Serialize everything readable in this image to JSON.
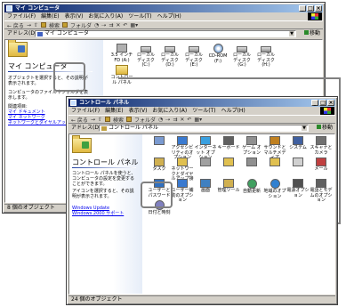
{
  "colors": {
    "title_start": "#0a246a",
    "title_end": "#a6caf0",
    "chrome": "#d4d0c8",
    "link": "#0000ee",
    "callout": "#808080"
  },
  "win1": {
    "title": "マイ コンピュータ",
    "menu": [
      "ファイル(F)",
      "編集(E)",
      "表示(V)",
      "お気に入り(A)",
      "ツール(T)",
      "ヘルプ(H)"
    ],
    "toolbar": {
      "back": "← 戻る",
      "search": "検索",
      "folders": "フォルダ"
    },
    "address_label": "アドレス(D)",
    "address_value": "マイ コンピュータ",
    "go": "移動",
    "panel_title": "マイ コンピュータ",
    "panel_desc": "オブジェクトを選択すると、その説明が表示されます。",
    "panel_desc2": "コンピュータのファイルやフォルダを表示します。",
    "related_heading": "関連項目:",
    "links": [
      "マイ ドキュメント",
      "マイ ネットワーク",
      "ネットワークとダイヤルアップ接続"
    ],
    "icons": [
      {
        "label": "3.5 インチ FD (A:)",
        "icon": "floppy-icon"
      },
      {
        "label": "ローカル ディスク (C:)",
        "icon": "drive-icon"
      },
      {
        "label": "ローカル ディスク (D:)",
        "icon": "drive-icon"
      },
      {
        "label": "ローカル ディスク (E:)",
        "icon": "drive-icon"
      },
      {
        "label": "CD-ROM (F:)",
        "icon": "cdrom-icon"
      },
      {
        "label": "ローカル ディスク (G:)",
        "icon": "drive-icon"
      },
      {
        "label": "ローカル ディスク (H:)",
        "icon": "drive-icon"
      }
    ],
    "control_panel_label": "コントロール パネル",
    "status": "8 個のオブジェクト"
  },
  "win2": {
    "title": "コントロール パネル",
    "menu": [
      "ファイル(F)",
      "編集(E)",
      "表示(V)",
      "お気に入り(A)",
      "ツール(T)",
      "ヘルプ(H)"
    ],
    "toolbar": {
      "back": "← 戻る",
      "search": "検索",
      "folders": "フォルダ"
    },
    "address_label": "アドレス(D)",
    "address_value": "コントロール パネル",
    "go": "移動",
    "panel_title": "コントロール パネル",
    "panel_desc": "コントロール パネルを使うと、コンピュータの設定を変更することができます。",
    "panel_desc2": "アイコンを選択すると、その説明が表示されます。",
    "links": [
      "Windows Update",
      "Windows 2000 サポート"
    ],
    "icons": [
      {
        "label": "",
        "icon": "app-icon"
      },
      {
        "label": "アクセシビリティのオプション",
        "icon": "accessibility-icon"
      },
      {
        "label": "インターネット オプション",
        "icon": "internet-icon"
      },
      {
        "label": "キーボード",
        "icon": "keyboard-icon"
      },
      {
        "label": "ゲーム オプション",
        "icon": "game-icon"
      },
      {
        "label": "サウンドとマルチメディア",
        "icon": "sound-icon"
      },
      {
        "label": "システム",
        "icon": "system-icon"
      },
      {
        "label": "スキャナとカメラ",
        "icon": "scanner-icon"
      },
      {
        "label": "タスク",
        "icon": "tasks-icon"
      },
      {
        "label": "ネットワークとダイヤルアップ接続",
        "icon": "network-folder-icon"
      },
      {
        "label": "",
        "icon": "fonts-icon"
      },
      {
        "label": "",
        "icon": "folder-icon"
      },
      {
        "label": "",
        "icon": "printer-icon"
      },
      {
        "label": "",
        "icon": "folder-icon"
      },
      {
        "label": "",
        "icon": "mouse-icon"
      },
      {
        "label": "メール",
        "icon": "mail-icon"
      },
      {
        "label": "ユーザーとパスワード",
        "icon": "users-icon"
      },
      {
        "label": "ユーザー補助のオプション",
        "icon": "accessibility-icon"
      },
      {
        "label": "画面",
        "icon": "display-icon"
      },
      {
        "label": "管理ツール",
        "icon": "admin-tools-icon"
      },
      {
        "label": "自動更新",
        "icon": "update-icon"
      },
      {
        "label": "地域のオプション",
        "icon": "globe-icon"
      },
      {
        "label": "電源オプション",
        "icon": "power-icon"
      },
      {
        "label": "電話とモデムのオプション",
        "icon": "phone-icon"
      },
      {
        "label": "日付と時刻",
        "icon": "clock-icon"
      }
    ],
    "status": "24 個のオブジェクト"
  }
}
